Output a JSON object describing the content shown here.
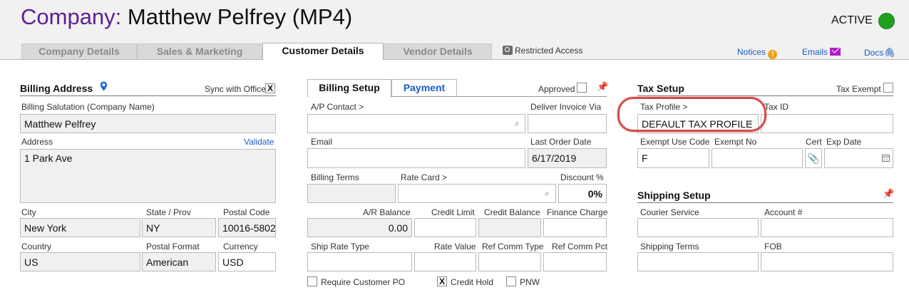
{
  "header": {
    "label": "Company:",
    "name": "Matthew Pelfrey  (MP4)",
    "status": "ACTIVE",
    "status_color": "#1fa11f"
  },
  "tabs": [
    "Company Details",
    "Sales & Marketing",
    "Customer Details",
    "Vendor Details"
  ],
  "restricted_access": "Restricted Access",
  "top_links": {
    "notices": "Notices",
    "emails": "Emails",
    "docs": "Docs"
  },
  "billing_address": {
    "title": "Billing Address",
    "sync_label": "Sync with Office",
    "sync_checked": "X",
    "salutation_label": "Billing Salutation (Company Name)",
    "salutation_value": "Matthew Pelfrey",
    "address_label": "Address",
    "validate_label": "Validate",
    "address_value": "1 Park Ave",
    "city_label": "City",
    "city_value": "New York",
    "state_label": "State / Prov",
    "state_value": "NY",
    "postal_label": "Postal Code",
    "postal_value": "10016-5802",
    "country_label": "Country",
    "country_value": "US",
    "postal_format_label": "Postal Format",
    "postal_format_value": "American",
    "currency_label": "Currency",
    "currency_value": "USD"
  },
  "billing_setup": {
    "tab_billing": "Billing Setup",
    "tab_payment": "Payment",
    "approved_label": "Approved",
    "ap_contact_label": "A/P Contact >",
    "deliver_invoice_label": "Deliver Invoice Via",
    "email_label": "Email",
    "last_order_label": "Last Order Date",
    "last_order_value": "6/17/2019",
    "billing_terms_label": "Billing Terms",
    "rate_card_label": "Rate Card >",
    "discount_label": "Discount %",
    "discount_value": "0%",
    "ar_balance_label": "A/R Balance",
    "ar_balance_value": "0.00",
    "credit_limit_label": "Credit Limit",
    "credit_balance_label": "Credit Balance",
    "finance_charge_label": "Finance Charge",
    "ship_rate_label": "Ship Rate Type",
    "rate_value_label": "Rate Value",
    "ref_comm_type_label": "Ref Comm Type",
    "ref_comm_pct_label": "Ref Comm Pct",
    "require_po_label": "Require Customer PO",
    "credit_hold_label": "Credit Hold",
    "credit_hold_checked": "X",
    "pnw_label": "PNW"
  },
  "tax_setup": {
    "title": "Tax Setup",
    "tax_exempt_label": "Tax Exempt",
    "tax_profile_label": "Tax Profile >",
    "tax_profile_value": "DEFAULT TAX PROFILE",
    "tax_id_label": "Tax ID",
    "exempt_use_label": "Exempt Use Code",
    "exempt_use_value": "F",
    "exempt_no_label": "Exempt No",
    "cert_label": "Cert",
    "exp_date_label": "Exp Date"
  },
  "shipping_setup": {
    "title": "Shipping Setup",
    "courier_label": "Courier Service",
    "account_label": "Account #",
    "shipping_terms_label": "Shipping Terms",
    "fob_label": "FOB"
  }
}
